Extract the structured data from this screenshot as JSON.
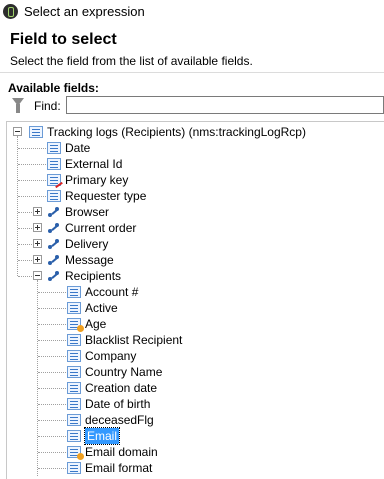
{
  "window": {
    "title": "Select an expression"
  },
  "header": {
    "title": "Field to select",
    "subtitle": "Select the field from the list of available fields."
  },
  "panel": {
    "label": "Available fields:"
  },
  "find": {
    "label": "Find:",
    "value": "",
    "placeholder": ""
  },
  "tree": {
    "root": "Tracking logs (Recipients) (nms:trackingLogRcp)",
    "root_children": [
      {
        "label": "Date",
        "icon": "field-icon"
      },
      {
        "label": "External Id",
        "icon": "field-icon"
      },
      {
        "label": "Primary key",
        "icon": "primary-key-field-icon"
      },
      {
        "label": "Requester type",
        "icon": "field-icon"
      },
      {
        "label": "Browser",
        "icon": "link-icon"
      },
      {
        "label": "Current order",
        "icon": "link-icon"
      },
      {
        "label": "Delivery",
        "icon": "link-icon"
      },
      {
        "label": "Message",
        "icon": "link-icon"
      },
      {
        "label": "Recipients",
        "icon": "link-icon"
      }
    ],
    "recipients_children": [
      {
        "label": "Account #",
        "icon": "field-icon"
      },
      {
        "label": "Active",
        "icon": "field-icon"
      },
      {
        "label": "Age",
        "icon": "computed-field-icon"
      },
      {
        "label": "Blacklist Recipient",
        "icon": "field-icon"
      },
      {
        "label": "Company",
        "icon": "field-icon"
      },
      {
        "label": "Country Name",
        "icon": "field-icon"
      },
      {
        "label": "Creation date",
        "icon": "field-icon"
      },
      {
        "label": "Date of birth",
        "icon": "field-icon"
      },
      {
        "label": "deceasedFlg",
        "icon": "field-icon"
      },
      {
        "label": "Email",
        "icon": "field-icon",
        "selected": true
      },
      {
        "label": "Email domain",
        "icon": "computed-field-icon"
      },
      {
        "label": "Email format",
        "icon": "field-icon"
      }
    ]
  },
  "colors": {
    "selection": "#3399ff",
    "icon_blue": "#3a78c8",
    "link_blue": "#2a5faa"
  }
}
